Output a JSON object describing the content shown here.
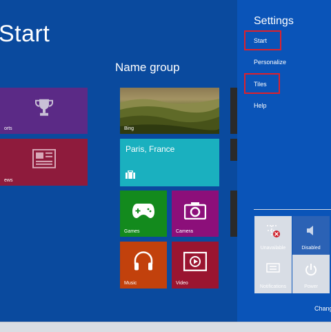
{
  "start": {
    "title": "Start",
    "group_name": "Name group"
  },
  "tiles": {
    "sports": {
      "label": "orts",
      "icon": "trophy-icon"
    },
    "news": {
      "label": "ews",
      "icon": "newspaper-icon"
    },
    "bing": {
      "label": "Bing"
    },
    "weather": {
      "city": "Paris, France",
      "icon": "briefcase-icon"
    },
    "games": {
      "label": "Games",
      "icon": "gamepad-icon"
    },
    "camera": {
      "label": "Camera",
      "icon": "camera-icon"
    },
    "music": {
      "label": "Music",
      "icon": "headphones-icon"
    },
    "video": {
      "label": "Video",
      "icon": "video-icon"
    }
  },
  "settings": {
    "title": "Settings",
    "items": [
      "Start",
      "Personalize",
      "Tiles",
      "Help"
    ],
    "highlighted": [
      "Start",
      "Tiles"
    ],
    "quick": [
      {
        "label": "Unavailable",
        "icon": "network-unavailable-icon"
      },
      {
        "label": "Disabled",
        "icon": "volume-icon"
      },
      {
        "label": "Notifications",
        "icon": "notifications-icon"
      },
      {
        "label": "Power",
        "icon": "power-icon"
      }
    ],
    "change_link": "Chang"
  },
  "colors": {
    "background": "#0a4a9e",
    "charm": "#0a54b8",
    "highlight_box": "#e0202a"
  }
}
